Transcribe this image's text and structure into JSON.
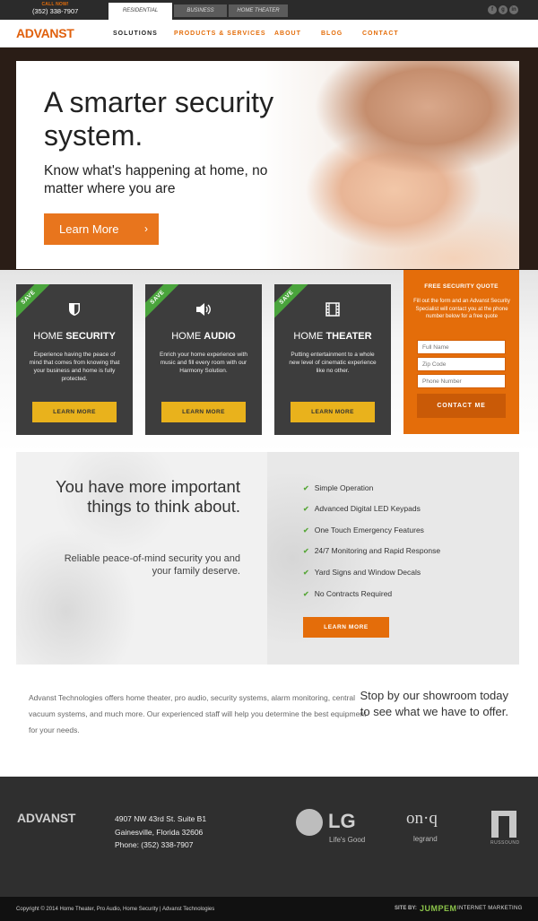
{
  "topbar": {
    "call_label": "CALL NOW!",
    "phone": "(352) 338-7907",
    "segments": [
      "RESIDENTIAL",
      "BUSINESS",
      "HOME THEATER"
    ],
    "social_icons": [
      "facebook-icon",
      "google-plus-icon",
      "linkedin-icon"
    ]
  },
  "nav": {
    "logo": "ADVANST",
    "items": [
      "SOLUTIONS",
      "PRODUCTS & SERVICES",
      "ABOUT",
      "BLOG",
      "CONTACT"
    ]
  },
  "hero": {
    "title": "A smarter security system.",
    "subtitle": "Know what's happening at home, no matter where you are",
    "button": "Learn More"
  },
  "cards": [
    {
      "ribbon": "SAVE",
      "icon": "shield-icon",
      "title_light": "HOME",
      "title_bold": "SECURITY",
      "desc": "Experience having the peace of mind that comes from knowing that your business and home is fully protected.",
      "button": "LEARN MORE"
    },
    {
      "ribbon": "SAVE",
      "icon": "speaker-icon",
      "title_light": "HOME",
      "title_bold": "AUDIO",
      "desc": "Enrich your home experience with music and fill every room with our Harmony Solution.",
      "button": "LEARN MORE"
    },
    {
      "ribbon": "SAVE",
      "icon": "film-icon",
      "title_light": "HOME",
      "title_bold": "THEATER",
      "desc": "Putting entertainment to a whole new level of cinematic experience like no other.",
      "button": "LEARN MORE"
    }
  ],
  "quote": {
    "title": "FREE SECURITY QUOTE",
    "desc": "Fill out the form and an Advanst Security Specialist will contact you at the phone number below for a free quote",
    "fields": [
      "Full Name",
      "Zip Code",
      "Phone Number"
    ],
    "button": "CONTACT ME"
  },
  "benefits": {
    "heading": "You have more important things to think about.",
    "sub": "Reliable peace-of-mind security you and your family deserve.",
    "features": [
      "Simple Operation",
      "Advanced Digital LED Keypads",
      "One Touch Emergency Features",
      "24/7 Monitoring and Rapid Response",
      "Yard Signs and Window Decals",
      "No Contracts Required"
    ],
    "button": "LEARN MORE"
  },
  "about": {
    "text": "Advanst Technologies offers home theater, pro audio, security systems, alarm monitoring, central vacuum systems, and much more. Our experienced staff will help you determine the best equipment for your needs.",
    "showroom": "Stop by our showroom today to see what we have to offer."
  },
  "footer": {
    "logo": "ADVANST",
    "address_line1": "4907 NW 43rd St. Suite B1",
    "address_line2": "Gainesville, Florida 32606",
    "phone": "Phone: (352) 338-7907",
    "partners": {
      "lg": "LG",
      "lg_tag": "Life's Good",
      "onq": "on·q",
      "legrand": "legrand",
      "russound": "RUSSOUND"
    },
    "copyright": "Copyright © 2014 Home Theater, Pro Audio, Home Security | Advanst Technologies",
    "site_by": "SITE BY:",
    "jumpem": "JUMPEM",
    "marketing": "INTERNET MARKETING"
  },
  "colors": {
    "accent": "#e46d0a",
    "button_yellow": "#e9b21c",
    "ribbon_green": "#4aa43c",
    "card_bg": "#3d3d3d",
    "footer_bg": "#2f2f2f"
  }
}
